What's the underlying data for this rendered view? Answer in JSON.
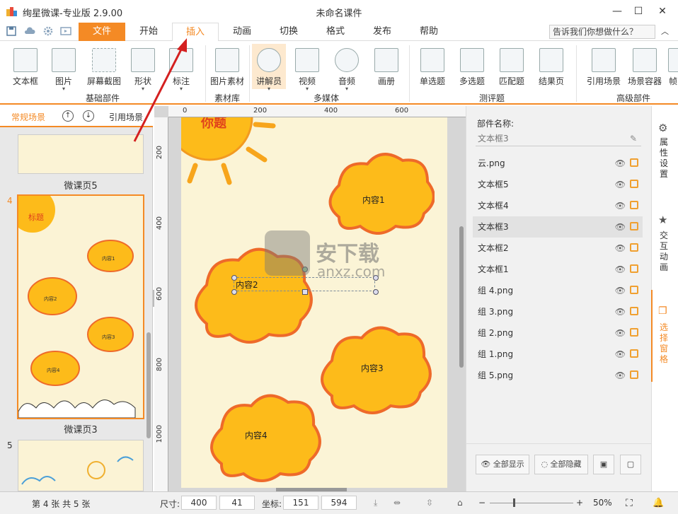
{
  "window": {
    "app_title": "绚星微课-专业版 2.9.00",
    "doc_title": "未命名课件"
  },
  "tabs": [
    {
      "label": "文件"
    },
    {
      "label": "开始"
    },
    {
      "label": "插入"
    },
    {
      "label": "动画"
    },
    {
      "label": "切换"
    },
    {
      "label": "格式"
    },
    {
      "label": "发布"
    },
    {
      "label": "帮助"
    }
  ],
  "help_search": "告诉我们你想做什么？",
  "ribbon": {
    "buttons": [
      "文本框",
      "图片",
      "屏幕截图",
      "形状",
      "标注",
      "图片素材",
      "讲解员",
      "视频",
      "音频",
      "画册",
      "单选题",
      "多选题",
      "匹配题",
      "结果页",
      "引用场景",
      "场景容器",
      "帧"
    ],
    "groups": [
      "基础部件",
      "素材库",
      "多媒体",
      "测评题",
      "高级部件"
    ]
  },
  "left_panel": {
    "tab_normal": "常规场景",
    "tab_ref": "引用场景",
    "pages": [
      {
        "label": "微课页5"
      },
      {
        "num": "4",
        "label": "微课页3",
        "title_text": "标题",
        "cloud_texts": [
          "内容1",
          "内容2",
          "内容3",
          "内容4"
        ]
      },
      {
        "num": "5"
      }
    ]
  },
  "ruler": {
    "top": [
      "0",
      "200",
      "400",
      "600"
    ],
    "left": [
      "200",
      "400",
      "600",
      "800",
      "1000"
    ]
  },
  "canvas": {
    "partial_title": "你题",
    "clouds": [
      "内容1",
      "内容2",
      "内容3",
      "内容4"
    ],
    "watermark_cn": "安下载",
    "watermark_en": "anxz.com"
  },
  "right_panel": {
    "part_name_label": "部件名称:",
    "part_name_value": "文本框3",
    "layers": [
      "云.png",
      "文本框5",
      "文本框4",
      "文本框3",
      "文本框2",
      "文本框1",
      "组 4.png",
      "组 3.png",
      "组 2.png",
      "组 1.png",
      "组 5.png"
    ],
    "selected_layer": "文本框3",
    "show_all": "全部显示",
    "hide_all": "全部隐藏"
  },
  "side_tabs": [
    "属性设置",
    "交互动画",
    "选择窗格"
  ],
  "status": {
    "page_info": "第 4 张  共 5 张",
    "size_label": "尺寸:",
    "width": "400",
    "height": "41",
    "coord_label": "坐标:",
    "x": "151",
    "y": "594",
    "zoom": "50%"
  },
  "colors": {
    "accent": "#f48a25",
    "cloud_fill": "#fdbb1a",
    "cloud_stroke": "#ee6a2a",
    "paper": "#fbf4d6"
  }
}
